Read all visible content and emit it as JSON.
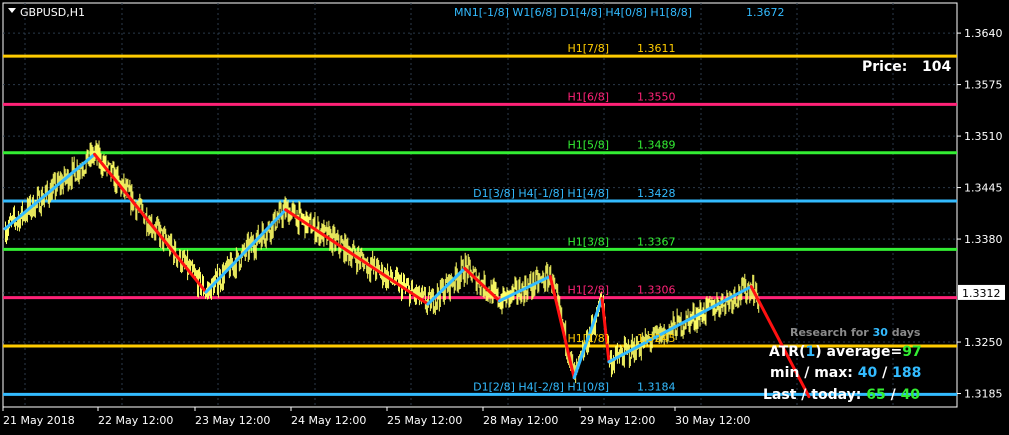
{
  "window": {
    "symbol_label": "GBPUSD,H1"
  },
  "colors": {
    "background": "#000000",
    "candle": "#ffff66",
    "grid": "#2b3a4a",
    "axis_text": "#ffffff",
    "zigzag_up": "#33bbff",
    "zigzag_down": "#ff1111"
  },
  "header_label": {
    "text": "MN1[-1/8] W1[6/8] D1[4/8] H4[0/8] H1[8/8]",
    "value": "1.3672",
    "color": "#33bbff"
  },
  "levels": [
    {
      "label": "H1[7/8]",
      "value": "1.3611",
      "price": 1.3611,
      "color": "#ffcc00",
      "label_color": "#ffcc00"
    },
    {
      "label": "H1[6/8]",
      "value": "1.3550",
      "price": 1.355,
      "color": "#ff2277",
      "label_color": "#ff2277"
    },
    {
      "label": "H1[5/8]",
      "value": "1.3489",
      "price": 1.3489,
      "color": "#33ee33",
      "label_color": "#33ee33"
    },
    {
      "label": "D1[3/8] H4[-1/8] H1[4/8]",
      "value": "1.3428",
      "price": 1.3428,
      "color": "#33bbff",
      "label_color": "#33bbff"
    },
    {
      "label": "H1[3/8]",
      "value": "1.3367",
      "price": 1.3367,
      "color": "#33ee33",
      "label_color": "#33ee33"
    },
    {
      "label": "H1[2/8]",
      "value": "1.3306",
      "price": 1.3306,
      "color": "#ff2277",
      "label_color": "#ff2277"
    },
    {
      "label": "H1[1/8]",
      "value": "1.3245",
      "price": 1.3245,
      "color": "#ffcc00",
      "label_color": "#ffcc00"
    },
    {
      "label": "D1[2/8] H4[-2/8] H1[0/8]",
      "value": "1.3184",
      "price": 1.3184,
      "color": "#33bbff",
      "label_color": "#33bbff"
    }
  ],
  "y_axis": {
    "ticks": [
      "1.3640",
      "1.3575",
      "1.3510",
      "1.3445",
      "1.3380",
      "1.3312",
      "1.3250",
      "1.3185"
    ],
    "tick_values": [
      1.364,
      1.3575,
      1.351,
      1.3445,
      1.338,
      1.3312,
      1.325,
      1.3185
    ],
    "current_price_label": "1.3312",
    "range": [
      1.3168,
      1.3678
    ]
  },
  "x_axis": {
    "ticks": [
      "21 May 2018",
      "22 May 12:00",
      "23 May 12:00",
      "24 May 12:00",
      "25 May 12:00",
      "28 May 12:00",
      "29 May 12:00",
      "30 May 12:00"
    ]
  },
  "info_panel": {
    "price_label": "Price:",
    "price_value": "104",
    "research_prefix": "Research for",
    "research_days": "30",
    "research_suffix": "days",
    "atr_prefix": "ATR(",
    "atr_period": "1",
    "atr_suffix": ") average=",
    "atr_average": "97",
    "minmax_label": "min / max:",
    "min_value": "40",
    "minmax_sep": "/",
    "max_value": "188",
    "last_label": "Last / today:",
    "last_value": "65",
    "last_sep": "/",
    "today_value": "40"
  },
  "chart_data": {
    "type": "line",
    "title": "GBPUSD,H1",
    "x": [
      "21 May 2018",
      "22 May 12:00",
      "23 May 12:00",
      "24 May 12:00",
      "25 May 12:00",
      "28 May 12:00",
      "29 May 12:00",
      "30 May 12:00"
    ],
    "ylim": [
      1.3168,
      1.3678
    ],
    "zigzag_pivots": [
      {
        "bar": 0,
        "price": 1.3393
      },
      {
        "bar": 90,
        "price": 1.3487
      },
      {
        "bar": 202,
        "price": 1.3313
      },
      {
        "bar": 282,
        "price": 1.3417
      },
      {
        "bar": 425,
        "price": 1.3298
      },
      {
        "bar": 462,
        "price": 1.3343
      },
      {
        "bar": 497,
        "price": 1.3302
      },
      {
        "bar": 548,
        "price": 1.3333
      },
      {
        "bar": 572,
        "price": 1.3205
      },
      {
        "bar": 600,
        "price": 1.3305
      },
      {
        "bar": 607,
        "price": 1.3225
      },
      {
        "bar": 750,
        "price": 1.332
      },
      {
        "bar": 808,
        "price": 1.3181
      }
    ],
    "grid": true
  }
}
